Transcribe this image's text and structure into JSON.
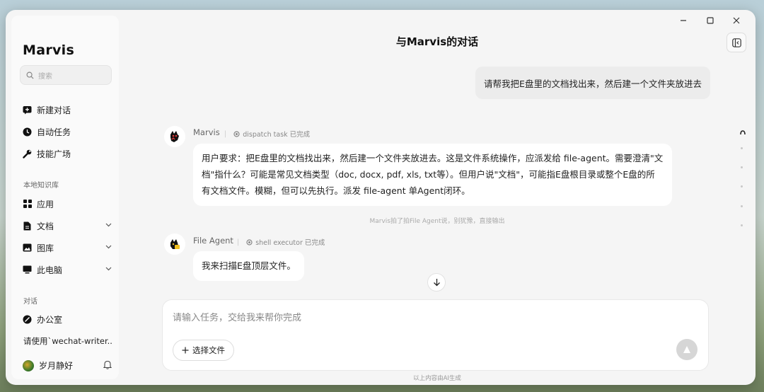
{
  "app": {
    "brand": "Marvis",
    "window_controls": {
      "minimize": "—",
      "maximize": "☐",
      "close": "✕"
    }
  },
  "sidebar": {
    "search_placeholder": "搜索",
    "primary": [
      {
        "label": "新建对话",
        "icon": "chat-plus-icon"
      },
      {
        "label": "自动任务",
        "icon": "clock-icon"
      },
      {
        "label": "技能广场",
        "icon": "wrench-icon"
      }
    ],
    "kb_section_title": "本地知识库",
    "kb_items": [
      {
        "label": "应用",
        "icon": "apps-grid-icon",
        "expandable": false
      },
      {
        "label": "文档",
        "icon": "document-icon",
        "expandable": true
      },
      {
        "label": "图库",
        "icon": "image-icon",
        "expandable": true
      },
      {
        "label": "此电脑",
        "icon": "monitor-icon",
        "expandable": true
      }
    ],
    "chats_section_title": "对话",
    "chat_items": [
      {
        "label": "办公室",
        "icon": "office-icon"
      },
      {
        "label": "请使用`wechat-writer..."
      }
    ],
    "user": {
      "name": "岁月静好"
    }
  },
  "conversation": {
    "title": "与Marvis的对话",
    "user_message": "请帮我把E盘里的文档找出来，然后建一个文件夹放进去",
    "marvis": {
      "name": "Marvis",
      "status": "dispatch task 已完成",
      "text": "用户要求：把E盘里的文档找出来，然后建一个文件夹放进去。这是文件系统操作，应派发给 file-agent。需要澄清\"文档\"指什么？可能是常见文档类型（doc, docx, pdf, xls, txt等）。但用户说\"文档\"，可能指E盘根目录或整个E盘的所有文档文件。模糊，但可以先执行。派发 file-agent 单Agent闭环。"
    },
    "handoff_note": "Marvis拍了拍File Agent说，别犹豫，直接输出",
    "file_agent": {
      "name": "File Agent",
      "status": "shell executor 已完成",
      "text": "我来扫描E盘顶层文件。"
    }
  },
  "composer": {
    "placeholder": "请输入任务，交给我来帮你完成",
    "attach_label": "选择文件"
  },
  "footer": "以上内容由AI生成",
  "colors": {
    "window_bg": "#f5f5f5",
    "bubble_bg": "#ffffff",
    "user_bubble_bg": "#ececec",
    "send_disabled": "#d6d6d6"
  }
}
